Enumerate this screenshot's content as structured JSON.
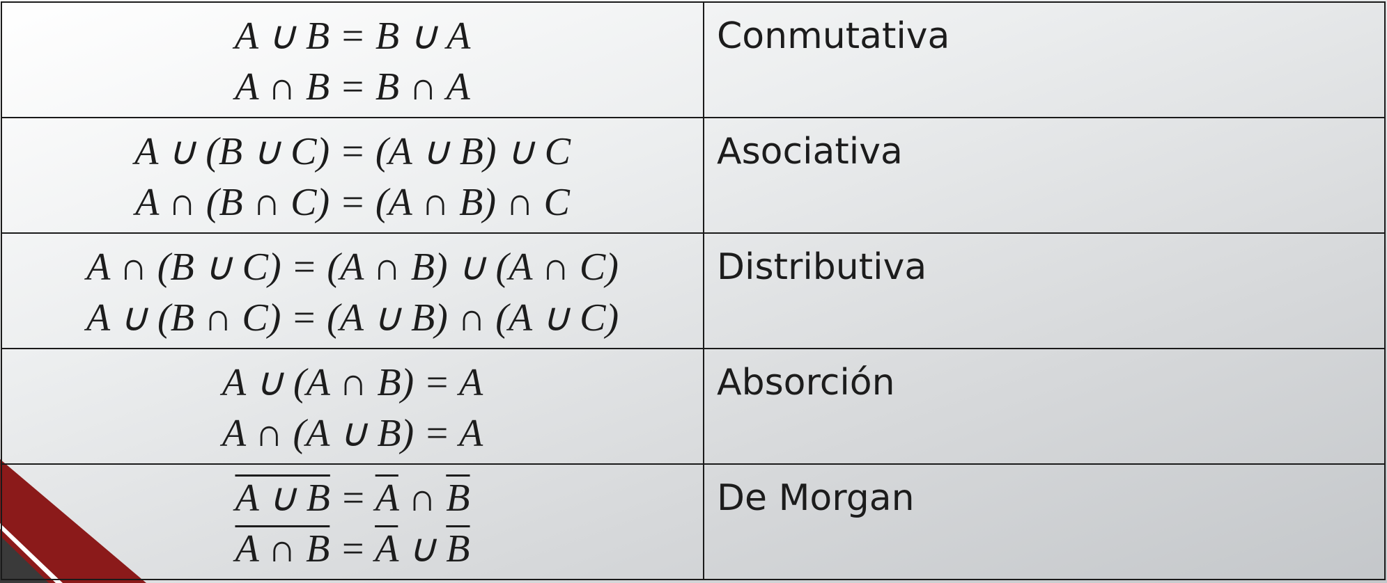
{
  "rows": [
    {
      "formulas": [
        "A ∪ B = B ∪ A",
        "A ∩ B = B ∩ A"
      ],
      "name": "Conmutativa"
    },
    {
      "formulas": [
        "A ∪ (B ∪ C) = (A ∪ B) ∪ C",
        "A ∩ (B ∩ C) = (A ∩ B) ∩ C"
      ],
      "name": "Asociativa"
    },
    {
      "formulas": [
        "A ∩ (B ∪ C) = (A ∩ B) ∪ (A ∩ C)",
        "A ∪ (B ∩ C) = (A ∪ B) ∩ (A ∪ C)"
      ],
      "name": "Distributiva"
    },
    {
      "formulas": [
        "A ∪ (A ∩ B) = A",
        "A ∩ (A ∪ B) = A"
      ],
      "name": "Absorción"
    },
    {
      "name": "De Morgan",
      "demorgan": [
        {
          "lhs": "A ∪ B",
          "mid": " = ",
          "a": "A",
          "op": " ∩ ",
          "b": "B"
        },
        {
          "lhs": "A ∩ B",
          "mid": " = ",
          "a": "A",
          "op": " ∪ ",
          "b": "B"
        }
      ]
    }
  ],
  "colors": {
    "accent_red": "#8b1a1a",
    "dark_gray": "#3a3a3a"
  }
}
